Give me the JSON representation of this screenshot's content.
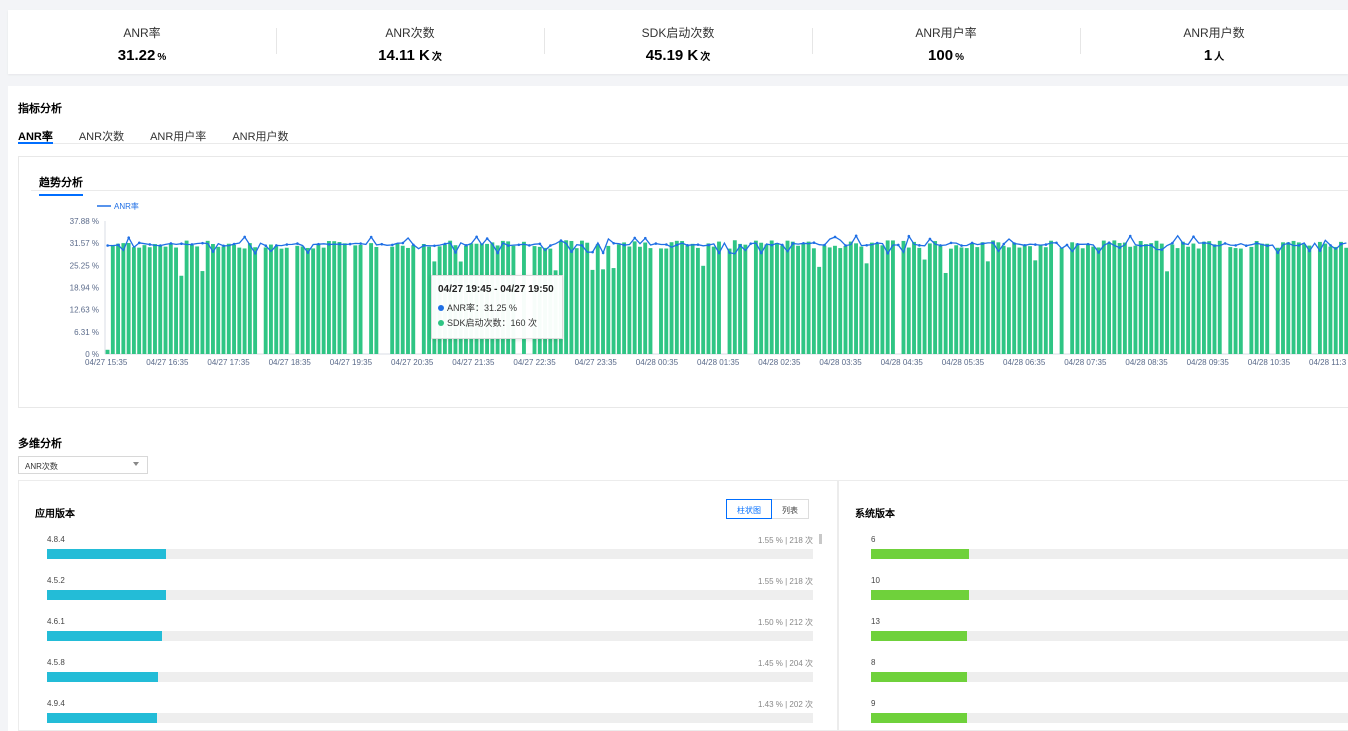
{
  "stats": [
    {
      "label": "ANR率",
      "value": "31.22",
      "unit": "%"
    },
    {
      "label": "ANR次数",
      "value": "14.11 K",
      "unit": "次"
    },
    {
      "label": "SDK启动次数",
      "value": "45.19 K",
      "unit": "次"
    },
    {
      "label": "ANR用户率",
      "value": "100",
      "unit": "%"
    },
    {
      "label": "ANR用户数",
      "value": "1",
      "unit": "人"
    }
  ],
  "metric_section": {
    "title": "指标分析",
    "tabs": [
      "ANR率",
      "ANR次数",
      "ANR用户率",
      "ANR用户数"
    ],
    "active_tab": "ANR率",
    "subtab": "趋势分析"
  },
  "chart_data": {
    "type": "bar",
    "legend": "ANR率",
    "y_ticks": [
      "37.88 %",
      "31.57 %",
      "25.25 %",
      "18.94 %",
      "12.63 %",
      "6.31 %",
      "0 %"
    ],
    "ylim": [
      0,
      37.88
    ],
    "x_ticks": [
      "04/27 15:35",
      "04/27 16:35",
      "04/27 17:35",
      "04/27 18:35",
      "04/27 19:35",
      "04/27 20:35",
      "04/27 21:35",
      "04/27 22:35",
      "04/27 23:35",
      "04/28 00:35",
      "04/28 01:35",
      "04/28 02:35",
      "04/28 03:35",
      "04/28 04:35",
      "04/28 05:35",
      "04/28 06:35",
      "04/28 07:35",
      "04/28 08:35",
      "04/28 09:35",
      "04/28 10:35",
      "04/28 11:3"
    ],
    "interval_minutes": 5,
    "bar_series": "SDK启动次数",
    "line_series": "ANR率",
    "typical_line_value": 31.2,
    "colors": {
      "bar": "#2fc584",
      "line": "#1f6fe5"
    }
  },
  "tooltip": {
    "title": "04/27 19:45 - 04/27 19:50",
    "line1": "ANR率：31.25 %",
    "line2": "SDK启动次数：160 次"
  },
  "multi_section": {
    "title": "多维分析",
    "select_value": "ANR次数"
  },
  "app_version": {
    "title": "应用版本",
    "toggle_bar": "柱状图",
    "toggle_list": "列表",
    "items": [
      {
        "label": "4.8.4",
        "value": "1.55 % | 218 次",
        "fraction": 0.0155
      },
      {
        "label": "4.5.2",
        "value": "1.55 % | 218 次",
        "fraction": 0.0155
      },
      {
        "label": "4.6.1",
        "value": "1.50 % | 212 次",
        "fraction": 0.015
      },
      {
        "label": "4.5.8",
        "value": "1.45 % | 204 次",
        "fraction": 0.0145
      },
      {
        "label": "4.9.4",
        "value": "1.43 % | 202 次",
        "fraction": 0.0143
      }
    ]
  },
  "os_version": {
    "title": "系统版本",
    "items": [
      {
        "label": "6",
        "fraction": 0.205
      },
      {
        "label": "10",
        "fraction": 0.205
      },
      {
        "label": "13",
        "fraction": 0.201
      },
      {
        "label": "8",
        "fraction": 0.2
      },
      {
        "label": "9",
        "fraction": 0.2
      }
    ]
  }
}
